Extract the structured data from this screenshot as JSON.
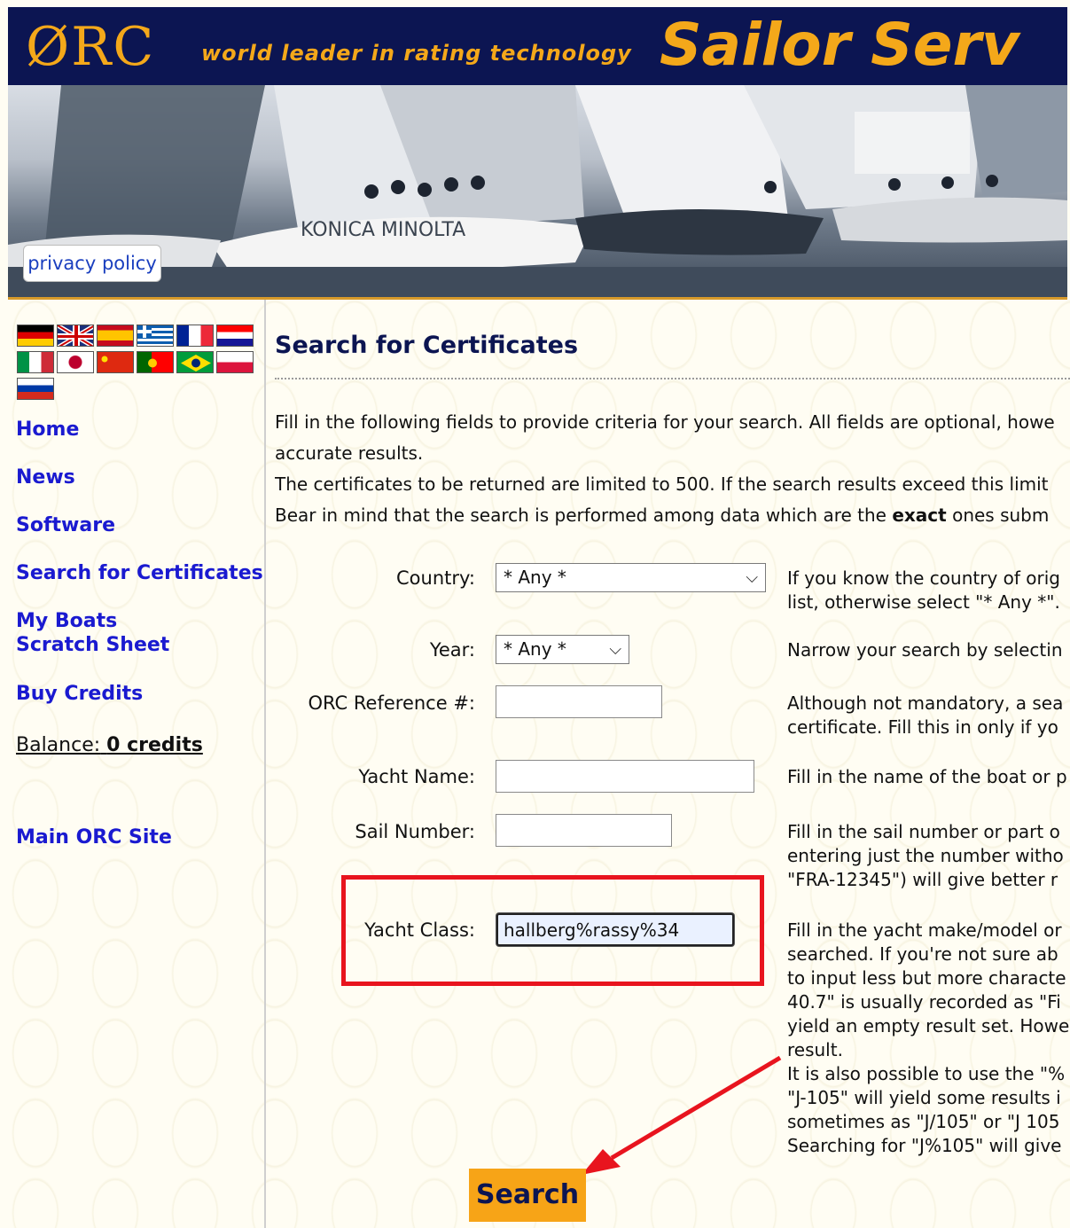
{
  "header": {
    "logo": "ØRC",
    "tagline": "world leader in rating technology",
    "title": "Sailor Serv",
    "privacy_link": "privacy policy"
  },
  "sidebar": {
    "flags": [
      "german-flag",
      "uk-flag",
      "spanish-flag",
      "greek-flag",
      "french-flag",
      "croatian-flag",
      "italian-flag",
      "japanese-flag",
      "chinese-flag",
      "portuguese-flag",
      "brazilian-flag",
      "polish-flag",
      "russian-flag"
    ],
    "nav": {
      "home": "Home",
      "news": "News",
      "software": "Software",
      "search": "Search for Certificates",
      "my_boats": "My Boats",
      "scratch_sheet": "Scratch Sheet",
      "buy_credits": "Buy Credits",
      "main_site": "Main ORC Site"
    },
    "balance_label": "Balance:",
    "balance_value": "0 credits"
  },
  "main": {
    "title": "Search for Certificates",
    "intro": [
      "Fill in the following fields to provide criteria for your search. All fields are optional, howe",
      "accurate results.",
      "The certificates to be returned are limited to 500. If the search results exceed this limit",
      "Bear in mind that the search is performed among data which are the "
    ],
    "intro_bold": "exact",
    "intro_tail": " ones subm",
    "form": {
      "country_label": "Country:",
      "country_value": "* Any *",
      "country_help": [
        "If you know the country of orig",
        "list, otherwise select \"* Any *\"."
      ],
      "year_label": "Year:",
      "year_value": "* Any *",
      "year_help": [
        "Narrow your search by selectin"
      ],
      "ref_label": "ORC Reference #:",
      "ref_value": "",
      "ref_help": [
        "Although not mandatory, a sea",
        "certificate. Fill this in only if yo"
      ],
      "name_label": "Yacht Name:",
      "name_value": "",
      "name_help": [
        "Fill in the name of the boat or p"
      ],
      "sail_label": "Sail Number:",
      "sail_value": "",
      "sail_help": [
        "Fill in the sail number or part o",
        "entering just the number witho",
        "\"FRA-12345\") will give better r"
      ],
      "class_label": "Yacht Class:",
      "class_value": "hallberg%rassy%34",
      "class_help": [
        "Fill in the yacht make/model or",
        "searched. If you're not sure ab",
        "to input less but more characte",
        "40.7\" is usually recorded as \"Fi",
        "yield an empty result set. Howe",
        "result.",
        "It is also possible to use the \"%",
        "\"J-105\" will yield some results i",
        "sometimes as \"J/105\" or \"J 105",
        "Searching for \"J%105\" will give"
      ]
    },
    "search_button": "Search"
  },
  "colors": {
    "navy": "#0c1552",
    "orange": "#f4a81a",
    "link_blue": "#1a1ad0",
    "annotation_red": "#e8141e"
  }
}
